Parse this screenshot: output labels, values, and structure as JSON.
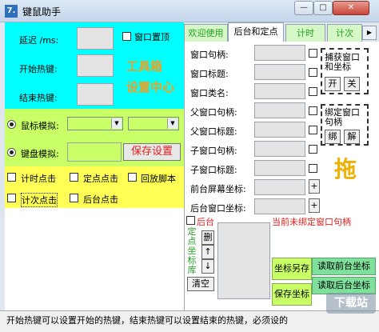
{
  "window": {
    "title": "键鼠助手",
    "icon_glyph": "7.",
    "minimize": "—",
    "maximize": "□",
    "close": "✕"
  },
  "hotkey_section": {
    "delay_label": "延迟 /ms:",
    "start_label": "开始热键:",
    "end_label": "结束热键:",
    "topmost_label": "窗口置顶",
    "tool_title": "工具箱",
    "tool_subtitle": "设置中心"
  },
  "sim_section": {
    "mouse_label": "鼠标模拟:",
    "keyboard_label": "键盘模拟:",
    "save_button": "保存设置"
  },
  "options": {
    "timed_click": "计时点击",
    "fixed_click": "定点点击",
    "replay_script": "回放脚本",
    "count_click": "计次点击",
    "background_click": "后台点击"
  },
  "tabs": [
    "欢迎使用",
    "后台和定点",
    "计时",
    "计次"
  ],
  "tab_scroll_icon": "chevron-right-icon",
  "right_panel": {
    "fields": [
      "窗口句柄:",
      "窗口标题:",
      "窗口类名:",
      "父窗口句柄:",
      "父窗口标题:",
      "子窗口句柄:",
      "子窗口标题:",
      "前台屏幕坐标:",
      "后台窗口坐标:"
    ],
    "plus": "+",
    "capture_title": "捕获窗口\n和坐标",
    "open": "开",
    "close": "关",
    "bind_title": "绑定窗口\n句柄",
    "bind": "绑",
    "unbind": "解",
    "drag": "拖",
    "backend_label": "后台",
    "status_red": "当前未绑定窗口句柄",
    "fixed_coord_lib": "定点坐标库",
    "delete": "删",
    "up": "↑",
    "down": "↓",
    "clear": "清空",
    "coord_save_as": "坐标另存",
    "read_front_coord": "读取前台坐标",
    "save_coord": "保存坐标",
    "read_back_coord": "读取后台坐标"
  },
  "status_bar": {
    "text": "开始热键可以设置开始的热键，结束热键可以设置结束的热键，必须设的",
    "watermark": "下载站"
  },
  "colors": {
    "hotkey_bg": "#00ffff",
    "sim_bg": "#c8ff66",
    "options_bg": "#ffff55",
    "accent_orange": "#f0a020",
    "save_red": "#e02020",
    "tab_green": "#23a023"
  }
}
